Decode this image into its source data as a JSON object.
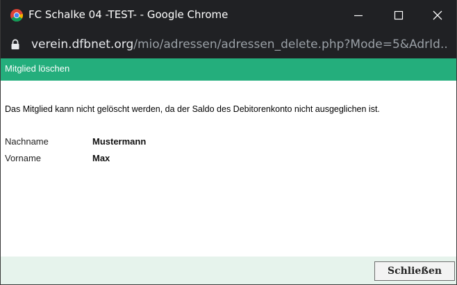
{
  "window": {
    "title": "FC Schalke 04 -TEST- - Google Chrome",
    "controls": {
      "minimize_icon": "minimize-icon",
      "maximize_icon": "maximize-icon",
      "close_icon": "close-icon"
    },
    "app_icon": "chrome-icon",
    "bar_color": "#202124"
  },
  "address": {
    "host": "verein.dfbnet.org",
    "path": "/mio/adressen/adressen_delete.php?Mode=5&AdrId...",
    "lock_icon": "lock-icon"
  },
  "dialog": {
    "title": "Mitglied löschen",
    "header_color": "#24ae7c",
    "message": "Das Mitglied kann nicht gelöscht werden, da der Saldo des Debitorenkonto nicht ausgeglichen ist.",
    "fields": [
      {
        "label": "Nachname",
        "value": "Mustermann"
      },
      {
        "label": "Vorname",
        "value": "Max"
      }
    ],
    "close_button_label": "Schließen",
    "footer_color": "#e6f3ec"
  }
}
